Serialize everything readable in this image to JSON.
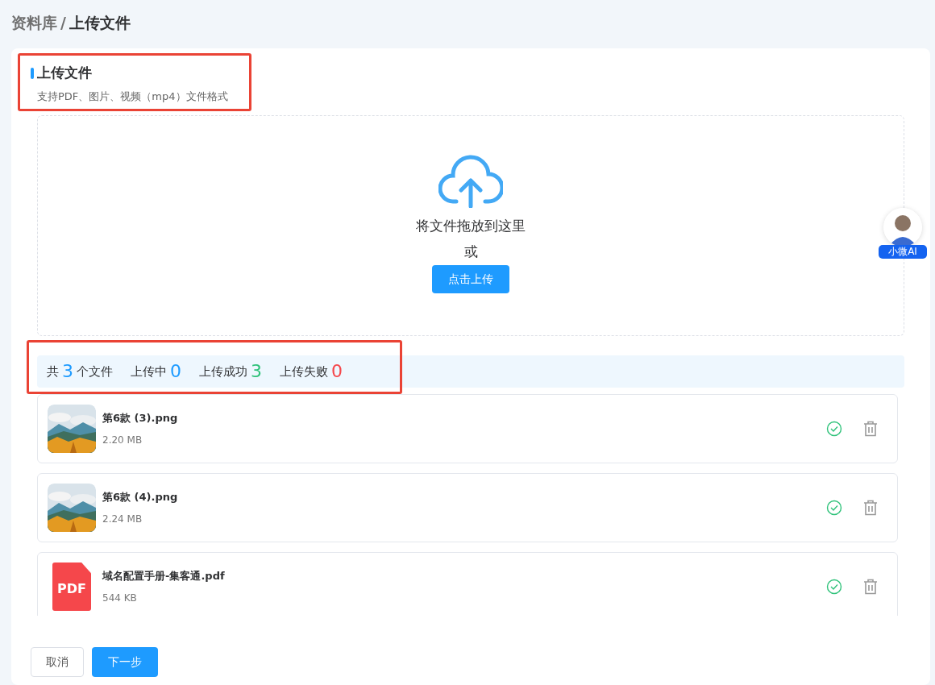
{
  "breadcrumb": {
    "parent": "资料库",
    "separator": "/",
    "current": "上传文件"
  },
  "section": {
    "title": "上传文件",
    "subtitle": "支持PDF、图片、视频（mp4）文件格式",
    "highlighted": true
  },
  "dropzone": {
    "hint": "将文件拖放到这里",
    "or": "或",
    "button": "点击上传"
  },
  "stats": {
    "highlighted": true,
    "items": [
      {
        "prefix": "共",
        "count": "3",
        "suffix": "个文件",
        "color": "#1e9bff"
      },
      {
        "prefix": "上传中",
        "count": "0",
        "color": "#1e9bff"
      },
      {
        "prefix": "上传成功",
        "count": "3",
        "color": "#2fc27a"
      },
      {
        "prefix": "上传失败",
        "count": "0",
        "color": "#f5474b"
      }
    ]
  },
  "files": [
    {
      "name": "第6款 (3).png",
      "size": "2.20 MB",
      "uploaded": true
    },
    {
      "name": "第6款 (4).png",
      "size": "2.24 MB",
      "uploaded": true
    },
    {
      "kind": "pdf",
      "badge": "PDF",
      "name": "域名配置手册-集客通.pdf",
      "size": "544 KB",
      "uploaded": true
    }
  ],
  "assistant": {
    "label": "小微AI"
  },
  "footer": {
    "cancel": "取消",
    "next": "下一步"
  }
}
